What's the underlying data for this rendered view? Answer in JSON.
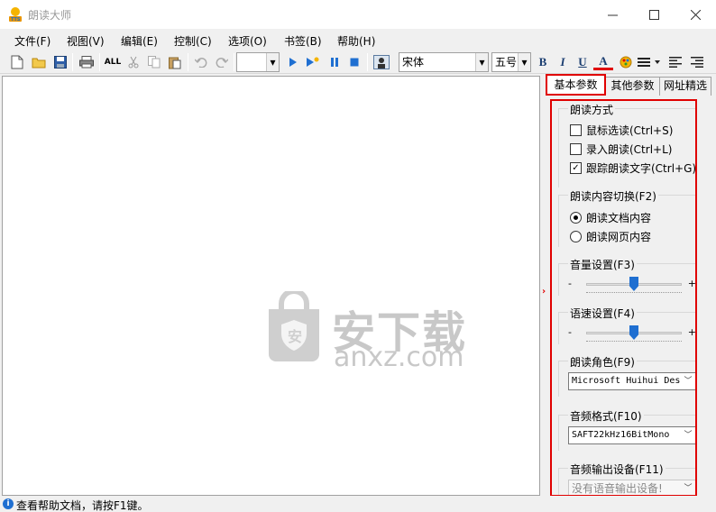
{
  "window": {
    "title": "朗读大师"
  },
  "menu": [
    "文件(F)",
    "视图(V)",
    "编辑(E)",
    "控制(C)",
    "选项(O)",
    "书签(B)",
    "帮助(H)"
  ],
  "toolbar": {
    "all_label": "ALL",
    "font_name": "宋体",
    "font_size": "五号",
    "bold": "B",
    "italic": "I",
    "underline": "U",
    "color": "A"
  },
  "tabs": [
    "基本参数",
    "其他参数",
    "网址精选"
  ],
  "panel": {
    "read_mode": {
      "title": "朗读方式",
      "options": [
        {
          "label": "鼠标选读(Ctrl+S)",
          "checked": false
        },
        {
          "label": "录入朗读(Ctrl+L)",
          "checked": false
        },
        {
          "label": "跟踪朗读文字(Ctrl+G)",
          "checked": true
        }
      ]
    },
    "content_switch": {
      "title": "朗读内容切换(F2)",
      "options": [
        {
          "label": "朗读文档内容",
          "selected": true
        },
        {
          "label": "朗读网页内容",
          "selected": false
        }
      ]
    },
    "volume": {
      "title": "音量设置(F3)",
      "minus": "-",
      "plus": "+",
      "level": 0.5
    },
    "speed": {
      "title": "语速设置(F4)",
      "minus": "-",
      "plus": "+",
      "level": 0.5
    },
    "voice": {
      "title": "朗读角色(F9)",
      "value": "Microsoft Huihui Des"
    },
    "format": {
      "title": "音频格式(F10)",
      "value": "SAFT22kHz16BitMono"
    },
    "output": {
      "title": "音频输出设备(F11)",
      "value": "没有语音输出设备!"
    }
  },
  "watermark": {
    "text": "安下载",
    "sub": "anxz.com"
  },
  "status": {
    "text": "查看帮助文档，请按F1键。"
  },
  "colors": {
    "highlight": "#e00000",
    "accent": "#1f6fd1"
  }
}
